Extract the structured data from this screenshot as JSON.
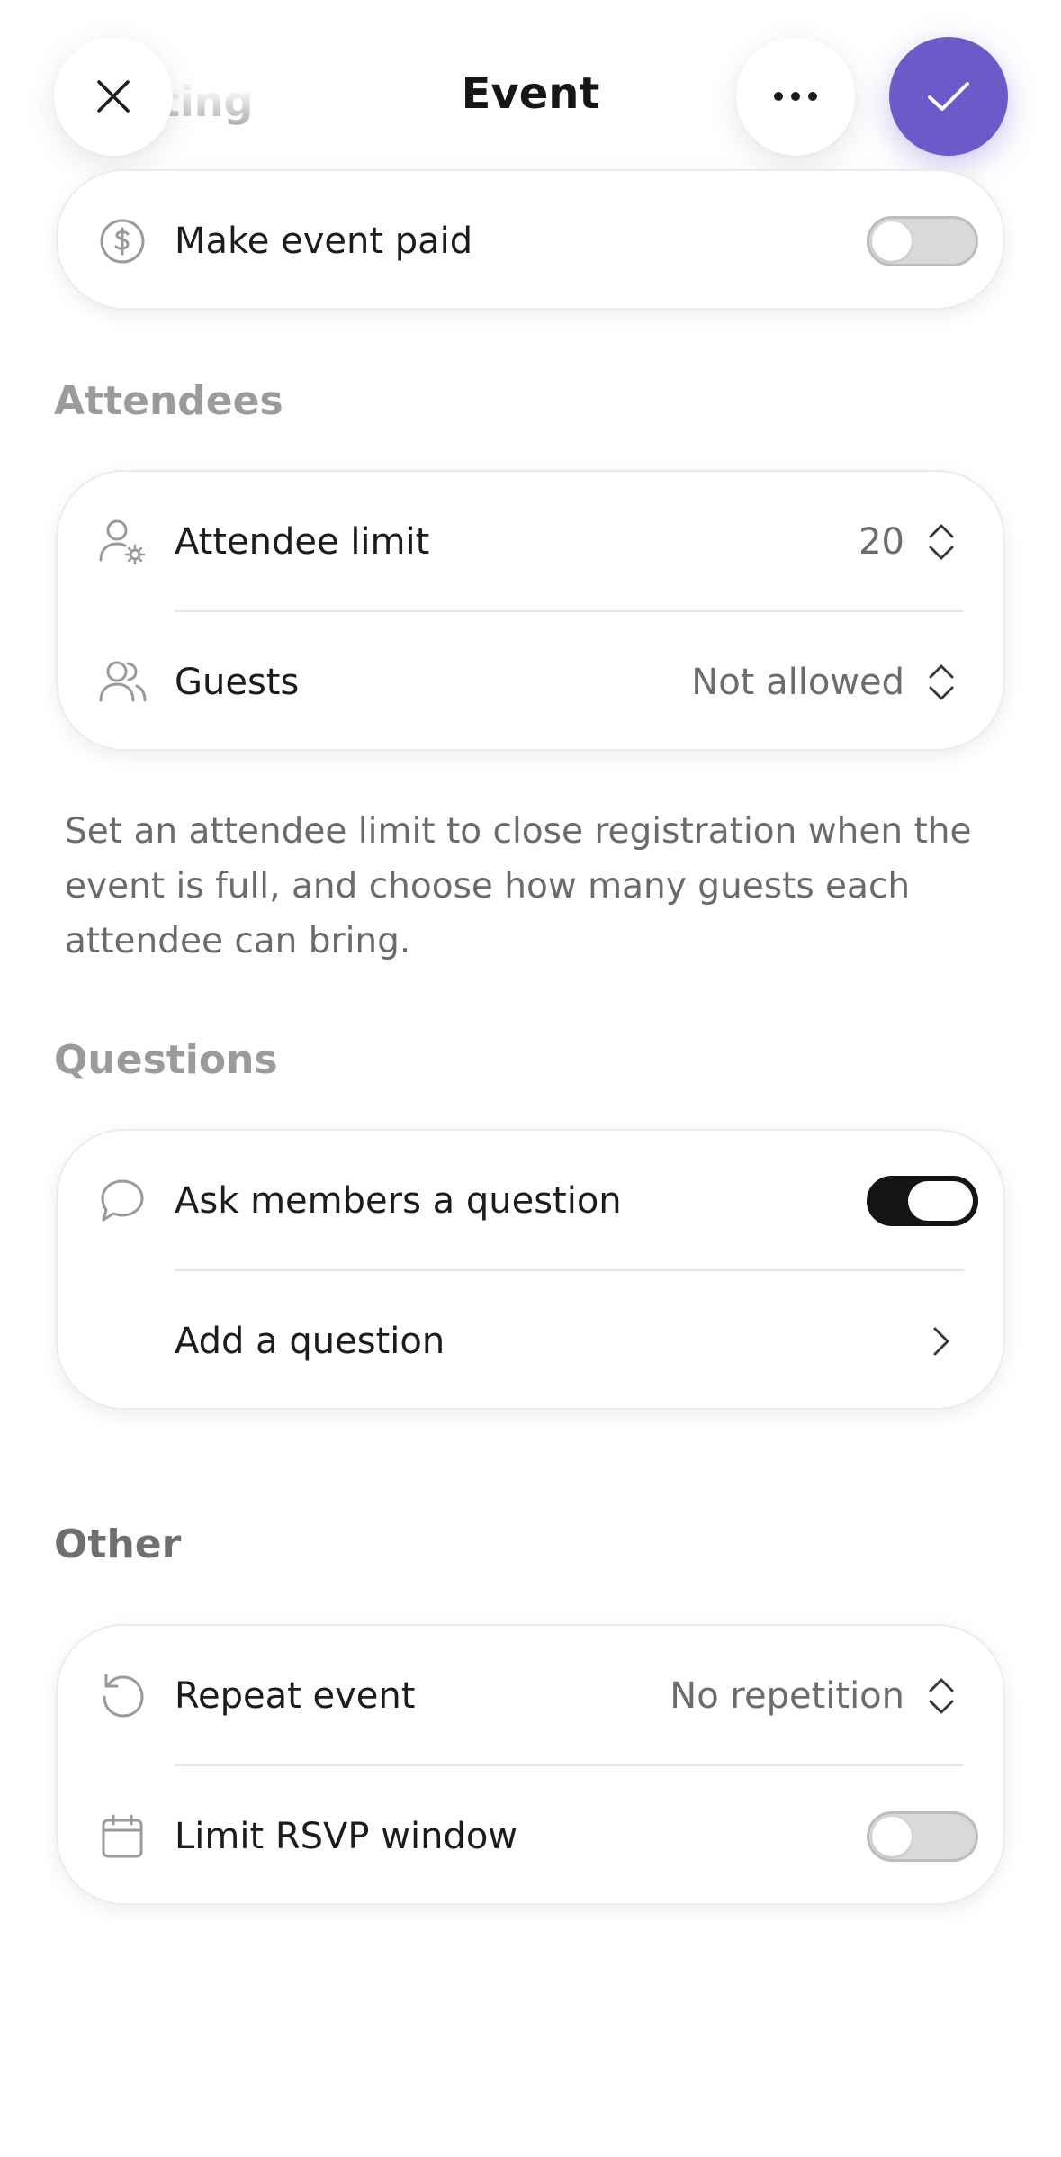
{
  "header": {
    "title": "Event",
    "peek_label": "ting",
    "icons": {
      "close": "close-icon",
      "more": "more-icon",
      "confirm": "check-icon"
    }
  },
  "paid": {
    "label": "Make event paid",
    "icon": "dollar-circle-icon",
    "enabled": false
  },
  "attendees": {
    "section_title": "Attendees",
    "rows": [
      {
        "label": "Attendee limit",
        "value": "20",
        "icon": "user-settings-icon"
      },
      {
        "label": "Guests",
        "value": "Not allowed",
        "icon": "users-icon"
      }
    ],
    "help_text": "Set an attendee limit to close registration when the event is full, and choose how many guests each attendee can bring."
  },
  "questions": {
    "section_title": "Questions",
    "ask_label": "Ask members a question",
    "ask_icon": "chat-bubble-icon",
    "ask_enabled": true,
    "add_label": "Add a question"
  },
  "other": {
    "section_title": "Other",
    "repeat_label": "Repeat event",
    "repeat_value": "No repetition",
    "repeat_icon": "repeat-icon",
    "rsvp_label": "Limit RSVP window",
    "rsvp_icon": "calendar-icon",
    "rsvp_enabled": false
  },
  "colors": {
    "accent": "#6e59c9",
    "toggle_on": "#141414",
    "toggle_off": "#d9d9d9",
    "secondary_text": "#6c6c70"
  }
}
